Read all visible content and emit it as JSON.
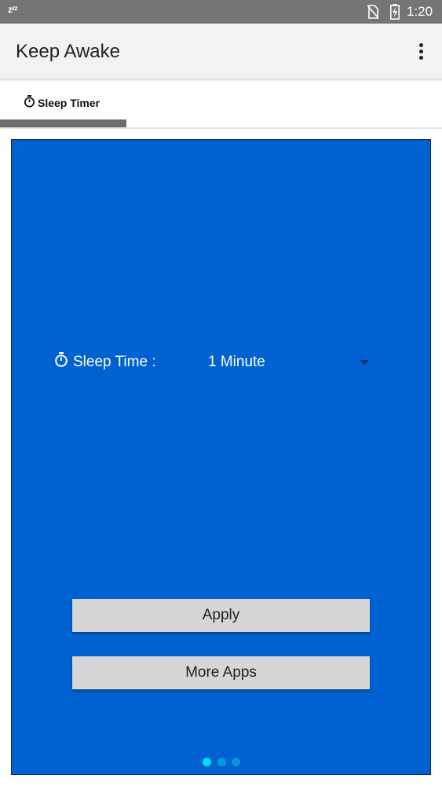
{
  "status_bar": {
    "time": "1:20",
    "sleep_glyph": "zᶻᶻ",
    "icons": [
      "sleep-mode-icon",
      "no-sim-icon",
      "battery-charging-icon"
    ]
  },
  "app_bar": {
    "title": "Keep Awake",
    "menu_icon": "overflow-menu-icon"
  },
  "tabs": [
    {
      "label": "Sleep Timer",
      "icon": "stopwatch-icon",
      "selected": true
    }
  ],
  "panel": {
    "background_color": "#0062d1",
    "sleep_time_label": "Sleep Time :",
    "sleep_time_value": "1 Minute",
    "apply_button": "Apply",
    "more_apps_button": "More Apps",
    "pager": {
      "pages": 3,
      "current": 1
    }
  },
  "colors": {
    "status_bar": "#757575",
    "app_bar": "#f2f2f2",
    "panel": "#0062d1",
    "button": "#d6d6d6",
    "pager_active": "#00d9ff",
    "pager_inactive": "#0a96dc"
  }
}
